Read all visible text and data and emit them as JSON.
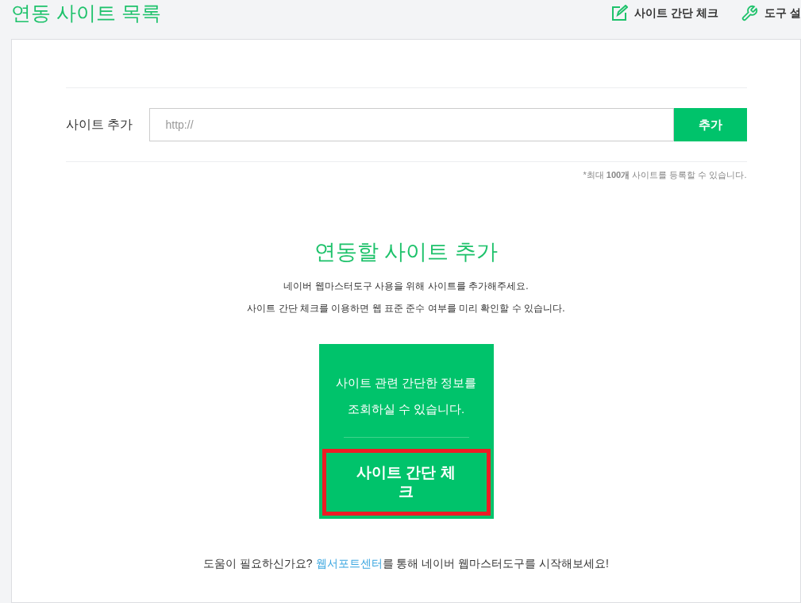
{
  "page_title": "연동 사이트 목록",
  "header_actions": [
    {
      "label": "사이트 간단 체크",
      "kind": "edit"
    },
    {
      "label": "도구 설",
      "kind": "wrench"
    }
  ],
  "add_site": {
    "label": "사이트 추가",
    "placeholder": "http://",
    "button": "추가",
    "note": "*최대 **100개** 사이트를 등록할 수 있습니다."
  },
  "intro": {
    "title": "연동할 사이트 추가",
    "lines": [
      "네이버 웹마스터도구 사용을 위해 사이트를 추가해주세요.",
      "사이트 간단 체크를 이용하면 웹 표준 준수 여부를 미리 확인할 수 있습니다."
    ]
  },
  "card": {
    "text_lines": [
      "사이트 관련 간단한 정보를",
      "조회하실 수 있습니다."
    ],
    "button": "사이트 간단 체크",
    "highlighted": true
  },
  "help": {
    "before": "도움이 필요하신가요? ",
    "link": "웹서포트센터",
    "after": "를 통해 네이버 웹마스터도구를 시작해보세요!"
  }
}
